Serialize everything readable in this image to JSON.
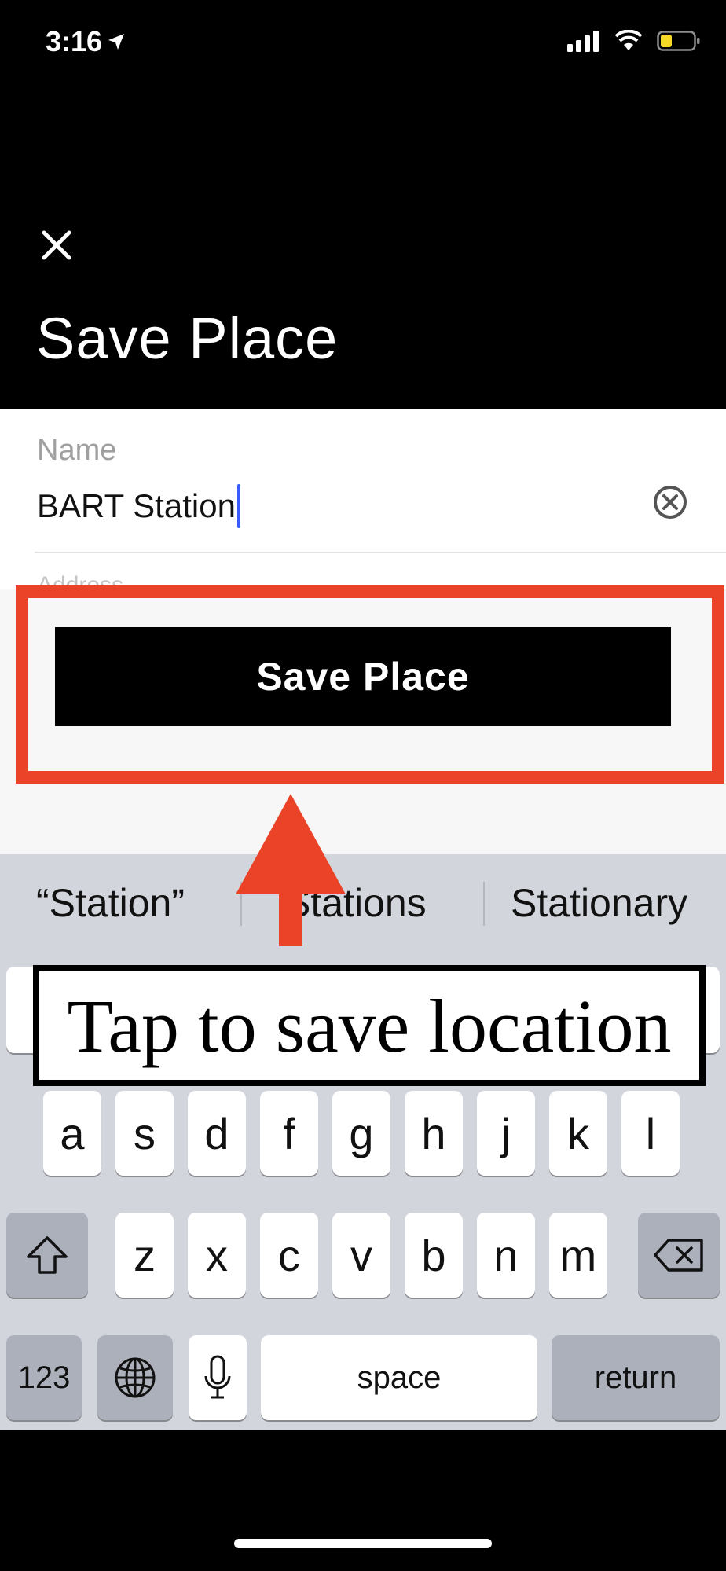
{
  "status_bar": {
    "time": "3:16"
  },
  "header": {
    "title": "Save Place"
  },
  "form": {
    "name_label": "Name",
    "name_value": "BART Station",
    "address_label_peek": "Address"
  },
  "save_button": {
    "label": "Save Place"
  },
  "annotation": {
    "text": "Tap to save location"
  },
  "keyboard": {
    "suggestions": [
      "“Station”",
      "Stations",
      "Stationary"
    ],
    "row2": [
      "a",
      "s",
      "d",
      "f",
      "g",
      "h",
      "j",
      "k",
      "l"
    ],
    "row3": [
      "z",
      "x",
      "c",
      "v",
      "b",
      "n",
      "m"
    ],
    "numbers_label": "123",
    "space_label": "space",
    "return_label": "return"
  },
  "colors": {
    "highlight": "#ea4328",
    "caret": "#3a5cff",
    "keyboard_bg": "#d2d5db"
  }
}
